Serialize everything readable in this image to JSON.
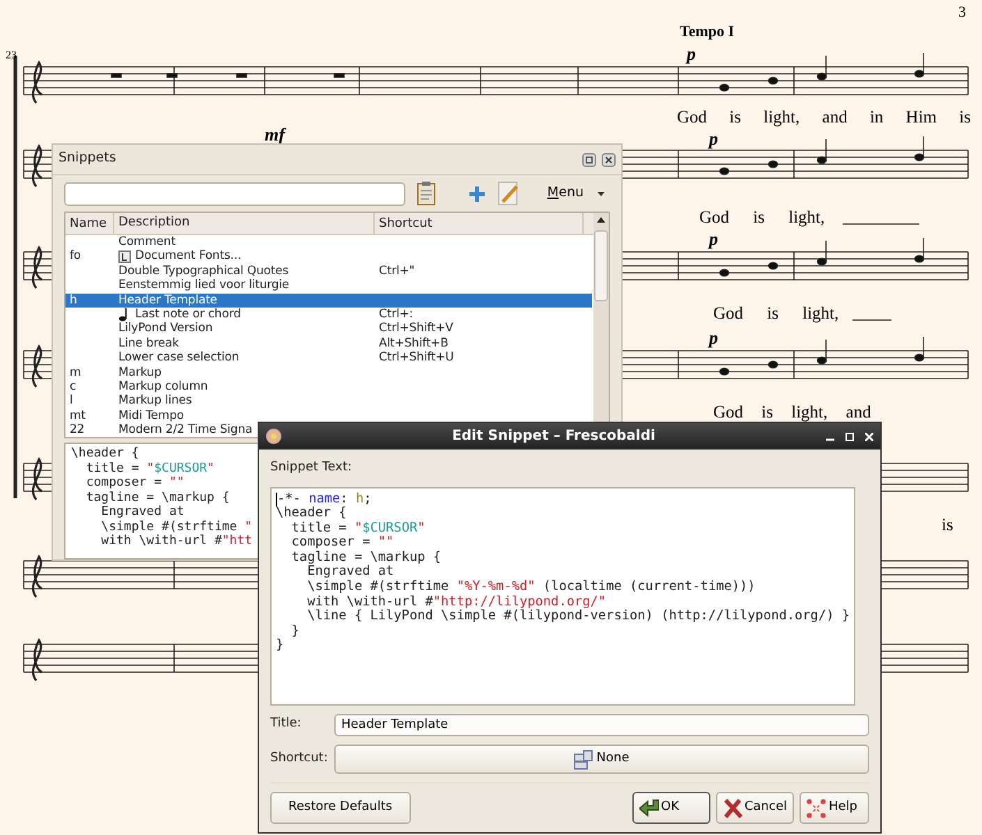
{
  "score": {
    "page_number": "3",
    "measure_number": "23",
    "tempo_mark": "Tempo I",
    "dynamics": [
      "p",
      "mf",
      "p",
      "p",
      "p"
    ],
    "lyrics": [
      "God is light, and in Him is",
      "God is light,",
      "God is light,",
      "God is light, and",
      "is"
    ]
  },
  "snippets_panel": {
    "title": "Snippets",
    "menu_button": "Menu",
    "columns": [
      "Name",
      "Description",
      "Shortcut"
    ],
    "rows": [
      {
        "description": "Comment",
        "kind": "plain",
        "selected": false
      },
      {
        "name": "fo",
        "description": "Document Fonts...",
        "kind": "fonts",
        "selected": false
      },
      {
        "description": "Double Typographical Quotes",
        "shortcut": "Ctrl+\"",
        "kind": "plain",
        "selected": false
      },
      {
        "description": "Eenstemmig lied voor liturgie",
        "kind": "plain",
        "selected": false
      },
      {
        "name": "h",
        "description": "Header Template",
        "kind": "plain",
        "selected": true
      },
      {
        "description": "Last note or chord",
        "shortcut": "Ctrl+:",
        "kind": "note",
        "selected": false
      },
      {
        "description": "LilyPond Version",
        "shortcut": "Ctrl+Shift+V",
        "kind": "plain",
        "selected": false
      },
      {
        "description": "Line break",
        "shortcut": "Alt+Shift+B",
        "kind": "plain",
        "selected": false
      },
      {
        "description": "Lower case selection",
        "shortcut": "Ctrl+Shift+U",
        "kind": "plain",
        "selected": false
      },
      {
        "name": "m",
        "description": "Markup",
        "kind": "plain",
        "selected": false
      },
      {
        "name": "c",
        "description": "Markup column",
        "kind": "plain",
        "selected": false
      },
      {
        "name": "l",
        "description": "Markup lines",
        "kind": "plain",
        "selected": false
      },
      {
        "name": "mt",
        "description": "Midi Tempo",
        "kind": "plain",
        "selected": false
      },
      {
        "name": "22",
        "description": "Modern 2/2 Time Signa",
        "kind": "plain",
        "selected": false
      }
    ],
    "preview": [
      [
        {
          "text": "\\header {",
          "kind": "plain"
        }
      ],
      [
        {
          "text": "  title = ",
          "kind": "plain"
        },
        {
          "text": "\"",
          "kind": "string"
        },
        {
          "text": "$CURSOR",
          "kind": "variable"
        },
        {
          "text": "\"",
          "kind": "string"
        }
      ],
      [
        {
          "text": "  composer = ",
          "kind": "plain"
        },
        {
          "text": "\"\"",
          "kind": "string"
        }
      ],
      [
        {
          "text": "  tagline = \\markup {",
          "kind": "plain"
        }
      ],
      [
        {
          "text": "    Engraved at",
          "kind": "plain"
        }
      ],
      [
        {
          "text": "    \\simple #(strftime ",
          "kind": "plain"
        },
        {
          "text": "\"",
          "kind": "string"
        }
      ],
      [
        {
          "text": "    with \\with-url #",
          "kind": "plain"
        },
        {
          "text": "\"htt",
          "kind": "string"
        }
      ]
    ]
  },
  "edit_dialog": {
    "title": "Edit Snippet – Frescobaldi",
    "text_label": "Snippet Text:",
    "code": [
      [
        {
          "text": "-*- ",
          "kind": "plain"
        },
        {
          "text": "name",
          "kind": "keyword"
        },
        {
          "text": ": ",
          "kind": "plain"
        },
        {
          "text": "h",
          "kind": "value"
        },
        {
          "text": ";",
          "kind": "plain"
        }
      ],
      [
        {
          "text": "\\header {",
          "kind": "plain"
        }
      ],
      [
        {
          "text": "  title = ",
          "kind": "plain"
        },
        {
          "text": "\"",
          "kind": "string"
        },
        {
          "text": "$CURSOR",
          "kind": "variable"
        },
        {
          "text": "\"",
          "kind": "string"
        }
      ],
      [
        {
          "text": "  composer = ",
          "kind": "plain"
        },
        {
          "text": "\"\"",
          "kind": "string"
        }
      ],
      [
        {
          "text": "  tagline = \\markup {",
          "kind": "plain"
        }
      ],
      [
        {
          "text": "    Engraved at",
          "kind": "plain"
        }
      ],
      [
        {
          "text": "    \\simple #(strftime ",
          "kind": "plain"
        },
        {
          "text": "\"%Y-%m-%d\"",
          "kind": "string"
        },
        {
          "text": " (localtime (current-time)))",
          "kind": "plain"
        }
      ],
      [
        {
          "text": "    with \\with-url #",
          "kind": "plain"
        },
        {
          "text": "\"http://lilypond.org/\"",
          "kind": "string"
        }
      ],
      [
        {
          "text": "    \\line { LilyPond \\simple #(lilypond-version) (http://lilypond.org/) }",
          "kind": "plain"
        }
      ],
      [
        {
          "text": "  }",
          "kind": "plain"
        }
      ],
      [
        {
          "text": "}",
          "kind": "plain"
        }
      ]
    ],
    "title_label": "Title:",
    "title_value": "Header Template",
    "shortcut_label": "Shortcut:",
    "shortcut_value": "None",
    "buttons": [
      {
        "label": "Restore Defaults",
        "kind": "plain",
        "default": false
      },
      {
        "label": "OK",
        "kind": "ok",
        "default": true
      },
      {
        "label": "Cancel",
        "kind": "cancel",
        "default": false
      },
      {
        "label": "Help",
        "kind": "help",
        "default": false
      }
    ]
  }
}
